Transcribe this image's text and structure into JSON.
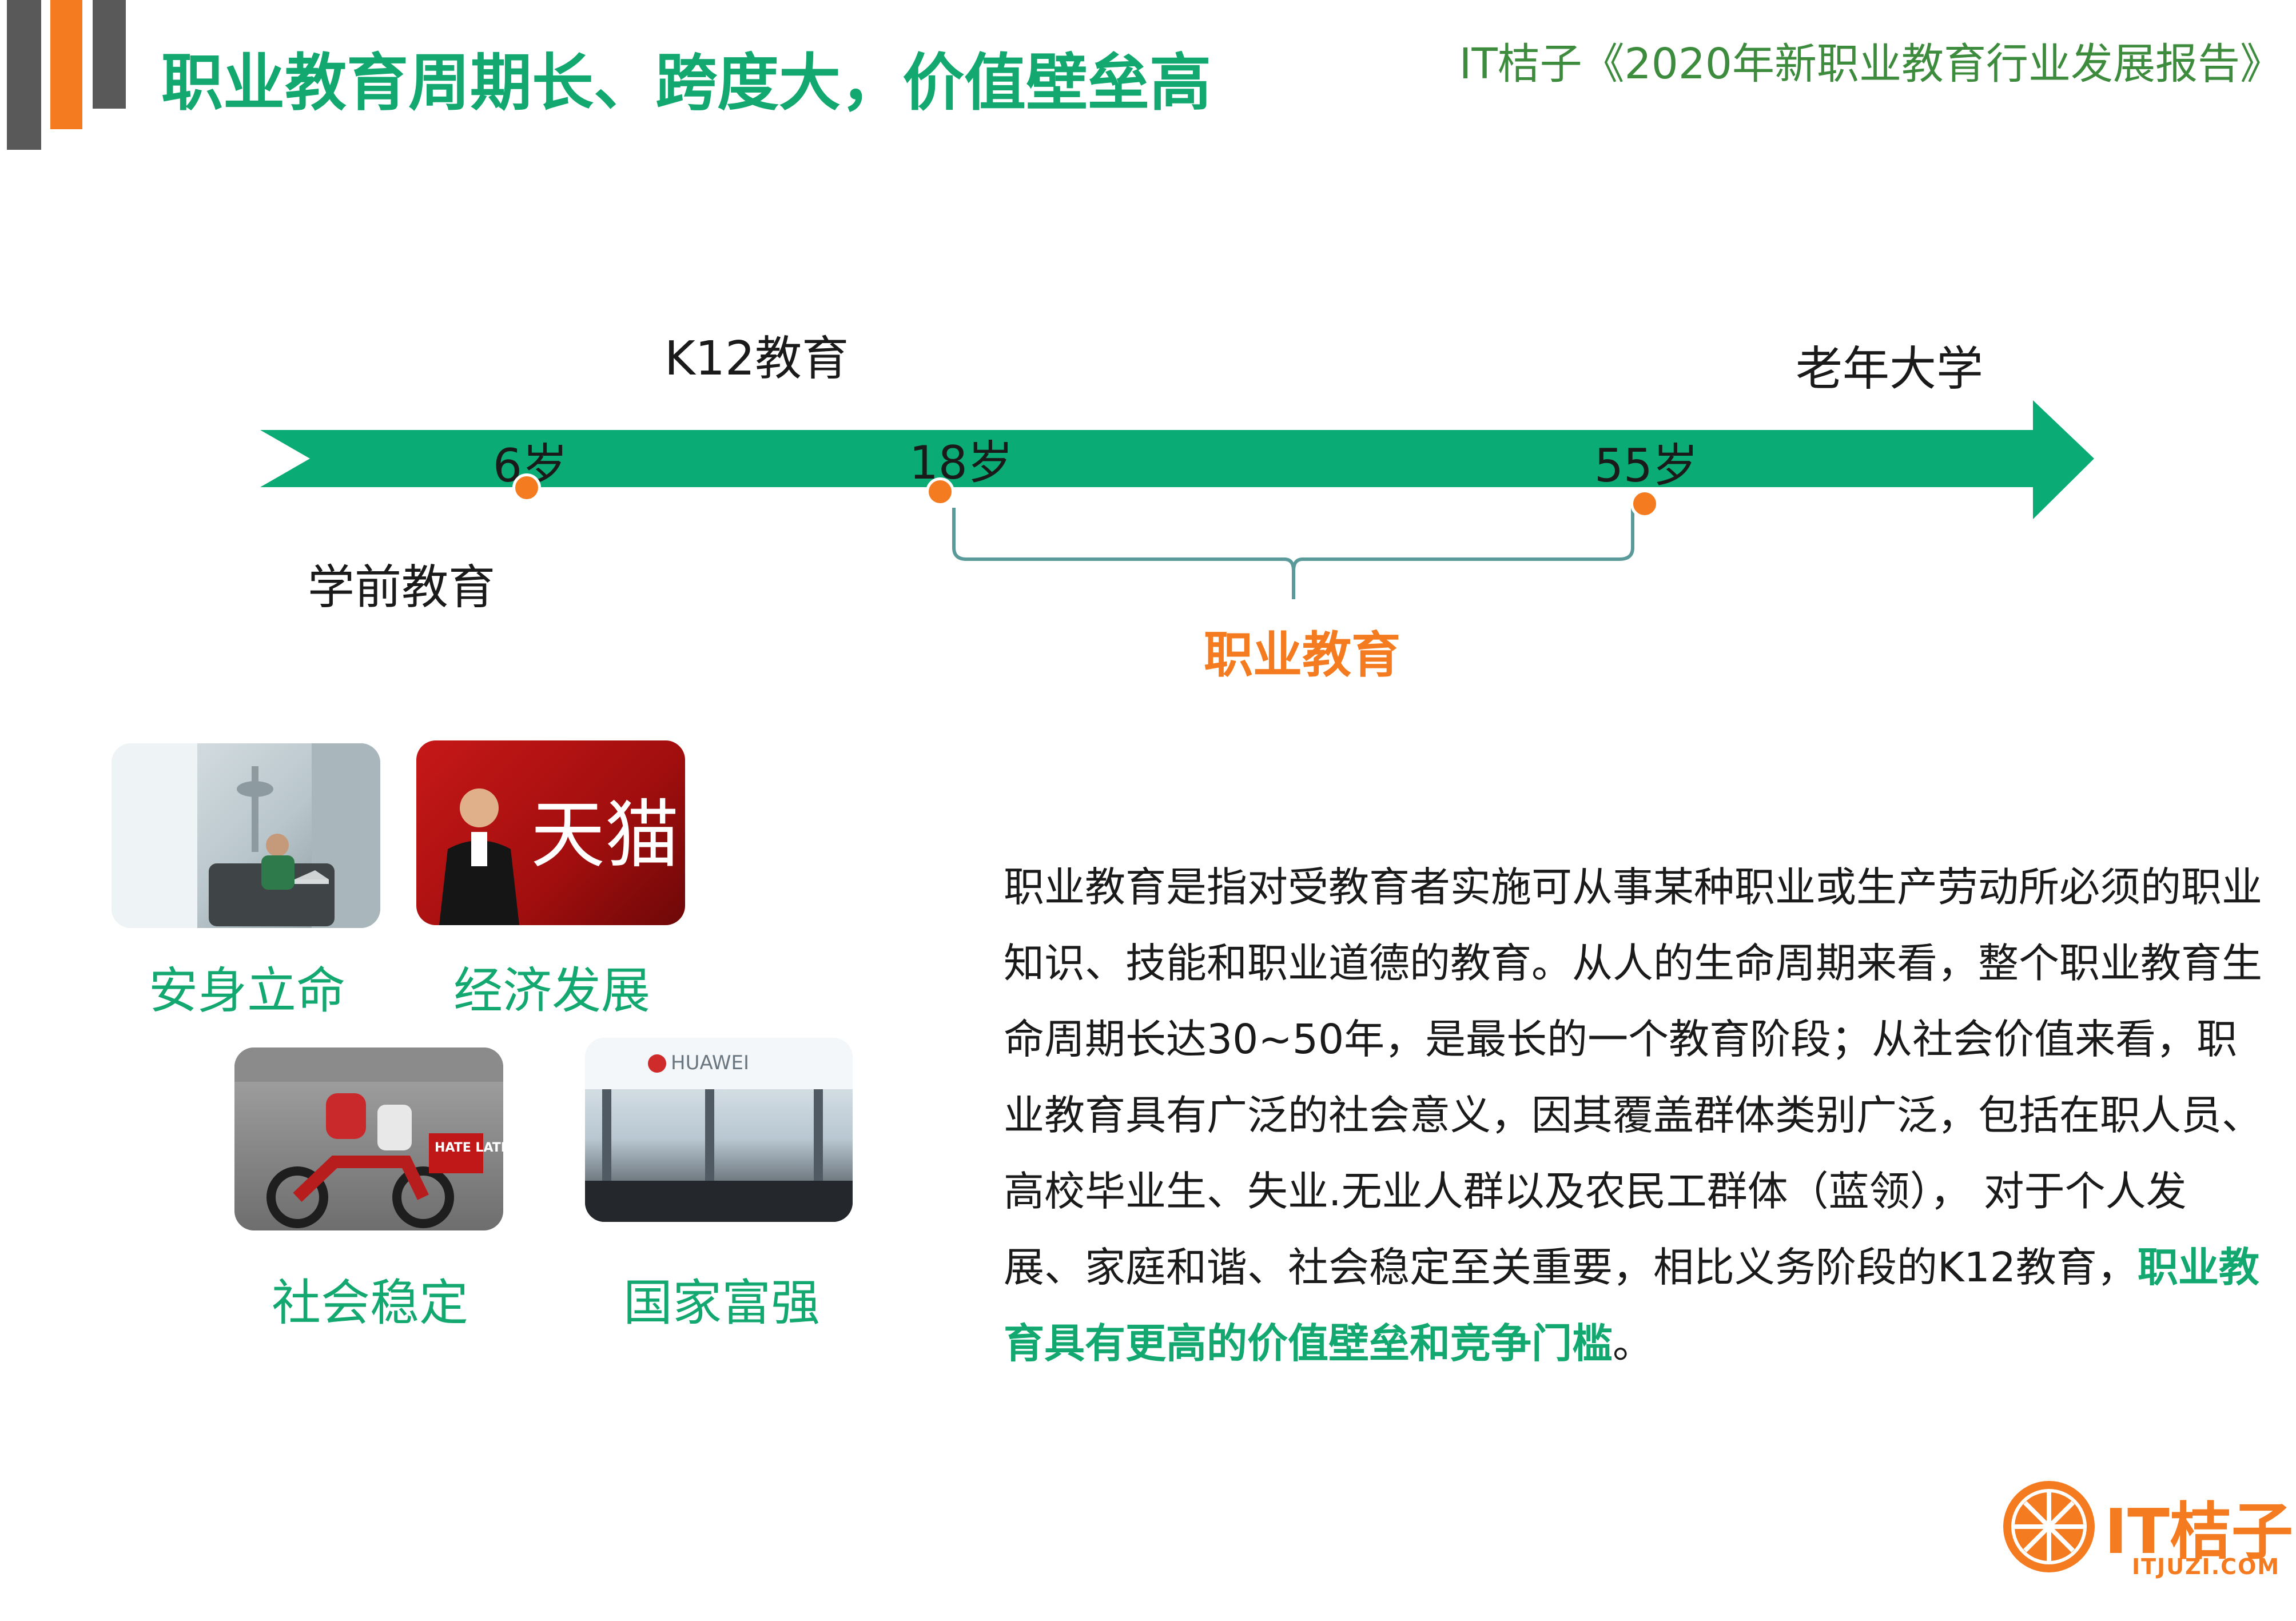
{
  "header": {
    "title": "职业教育周期长、跨度大，价值壁垒高",
    "report": "IT桔子《2020年新职业教育行业发展报告》"
  },
  "timeline": {
    "k12": "K12教育",
    "elderly": "老年大学",
    "preschool": "学前教育",
    "age_6": "6岁",
    "age_18": "18岁",
    "age_55": "55岁",
    "vocational": "职业教育"
  },
  "cards": [
    {
      "caption": "安身立命"
    },
    {
      "caption": "经济发展",
      "sign_text": "天猫"
    },
    {
      "caption": "社会稳定",
      "box_text": "HATE LATE"
    },
    {
      "caption": "国家富强",
      "sign_text": "HUAWEI"
    }
  ],
  "paragraph": {
    "text": "职业教育是指对受教育者实施可从事某种职业或生产劳动所必须的职业知识、技能和职业道德的教育。从人的生命周期来看，整个职业教育生命周期长达30~50年，是最长的一个教育阶段；从社会价值来看，职业教育具有广泛的社会意义，因其覆盖群体类别广泛，包括在职人员、高校毕业生、失业.无业人群以及农民工群体（蓝领）， 对于个人发展、家庭和谐、社会稳定至关重要，相比义务阶段的K12教育，",
    "highlight": "职业教育具有更高的价值壁垒和竞争门槛",
    "end": "。"
  },
  "logo": {
    "name": "IT桔子",
    "url": "ITJUZI.COM"
  },
  "colors": {
    "green": "#12a870",
    "orange": "#f47b20",
    "grey": "#595959",
    "report_green": "#3d8b3d"
  }
}
